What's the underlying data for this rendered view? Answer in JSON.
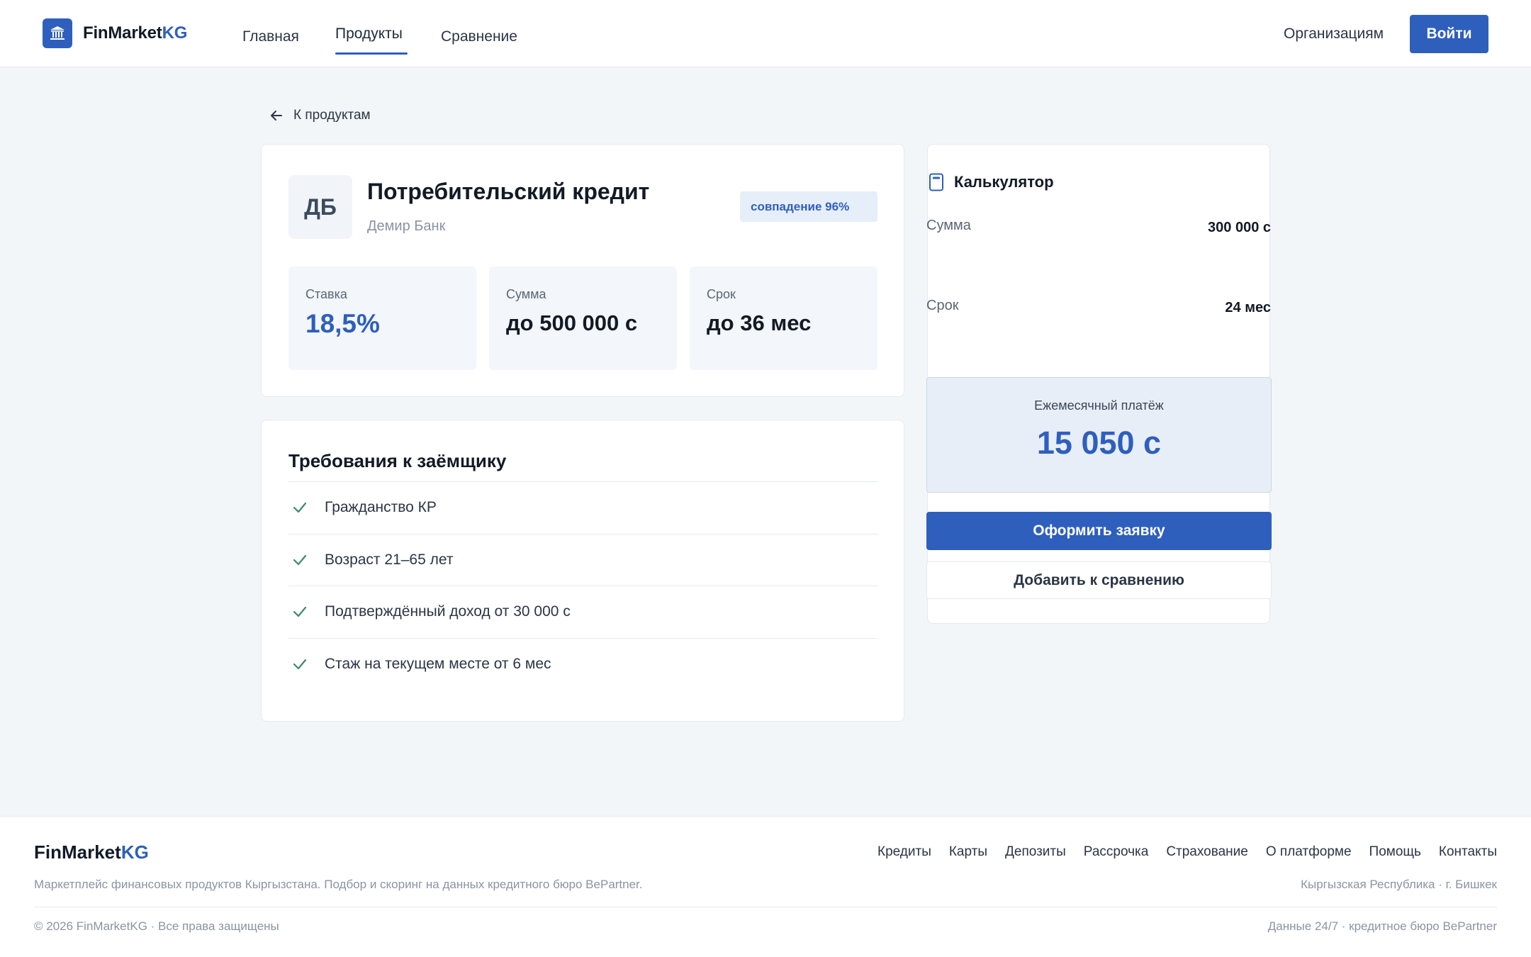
{
  "header": {
    "logo_main": "FinMarket",
    "logo_accent": "KG",
    "nav": [
      "Главная",
      "Продукты",
      "Сравнение"
    ],
    "active_nav": "Продукты",
    "org_link": "Организациям",
    "login_label": "Войти"
  },
  "back_link": "К продуктам",
  "product": {
    "bank_initials": "ДБ",
    "title": "Потребительский кредит",
    "bank": "Демир Банк",
    "match": "совпадение 96%",
    "stats": [
      {
        "label": "Ставка",
        "value": "18,5%"
      },
      {
        "label": "Сумма",
        "value": "до 500 000 с"
      },
      {
        "label": "Срок",
        "value": "до 36 мес"
      }
    ]
  },
  "requirements": {
    "title": "Требования к заёмщику",
    "items": [
      "Гражданство КР",
      "Возраст 21–65 лет",
      "Подтверждённый доход от 30 000 с",
      "Стаж на текущем месте от 6 мес"
    ]
  },
  "calculator": {
    "title": "Калькулятор",
    "amount_label": "Сумма",
    "amount_value": "300 000 с",
    "term_label": "Срок",
    "term_value": "24 мес",
    "monthly_label": "Ежемесячный платёж",
    "monthly_value": "15 050 с",
    "apply_label": "Оформить заявку",
    "compare_label": "Добавить к сравнению"
  },
  "footer": {
    "logo_main": "FinMarket",
    "logo_accent": "KG",
    "links": [
      "Кредиты",
      "Карты",
      "Депозиты",
      "Рассрочка",
      "Страхование",
      "О платформе",
      "Помощь",
      "Контакты"
    ],
    "description": "Маркетплейс финансовых продуктов Кыргызстана. Подбор и скоринг на данных кредитного бюро BePartner.",
    "location": "Кыргызская Республика · г. Бишкек",
    "copyright": "© 2026 FinMarketKG · Все права защищены",
    "data_note": "Данные 24/7 · кредитное бюро BePartner"
  },
  "colors": {
    "accent": "#2e5fbd",
    "background": "#f3f6f9",
    "check": "#3d8a6a"
  },
  "icons": {
    "logo": "bank-icon",
    "back": "arrow-left-icon",
    "calculator": "calculator-icon",
    "requirement": "check-icon"
  }
}
